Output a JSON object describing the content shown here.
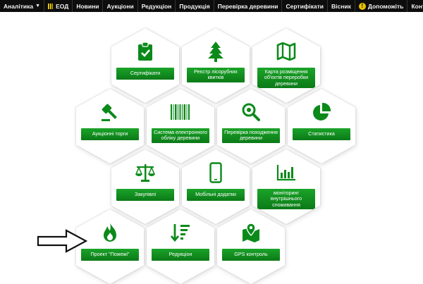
{
  "nav": {
    "items": [
      {
        "label": "Аналітика",
        "icon": "caret-down"
      },
      {
        "label": "ЕОД",
        "icon": "bars-icon"
      },
      {
        "label": "Новини"
      },
      {
        "label": "Аукціони"
      },
      {
        "label": "Редукціон"
      },
      {
        "label": "Продукція"
      },
      {
        "label": "Перевірка деревини"
      },
      {
        "label": "Сертифікати"
      },
      {
        "label": "Вісник"
      },
      {
        "label": "Допоможіть",
        "icon": "help-icon",
        "help_symbol": "!"
      },
      {
        "label": "Контакти"
      }
    ],
    "caret": "▼"
  },
  "tiles": [
    {
      "label": "Сертифікати",
      "icon": "clipboard-check-icon"
    },
    {
      "label": "Реєстр лісорубних квитків",
      "icon": "pine-tree-icon"
    },
    {
      "label": "Карта розміщення об'єктів переробки деревини",
      "icon": "map-icon"
    },
    {
      "label": "Аукціонні торги",
      "icon": "gavel-icon"
    },
    {
      "label": "Система електронного обліку деревини",
      "icon": "barcode-icon"
    },
    {
      "label": "Перевірка походження деревини",
      "icon": "magnifier-icon"
    },
    {
      "label": "Статистика",
      "icon": "pie-chart-icon"
    },
    {
      "label": "Закупівлі",
      "icon": "scales-icon"
    },
    {
      "label": "Мобільні додатки",
      "icon": "smartphone-icon"
    },
    {
      "label": "моніторинг внутрішнього споживання",
      "icon": "bar-chart-icon"
    },
    {
      "label": "Проект \"Пожежі\"",
      "icon": "flame-icon"
    },
    {
      "label": "Редукціон",
      "icon": "sort-descending-icon"
    },
    {
      "label": "GPS контроль",
      "icon": "map-pin-icon"
    }
  ],
  "colors": {
    "accent": "#0b8a1a",
    "nav_bg": "#0d0d0d",
    "nav_icon": "#e8c300"
  }
}
